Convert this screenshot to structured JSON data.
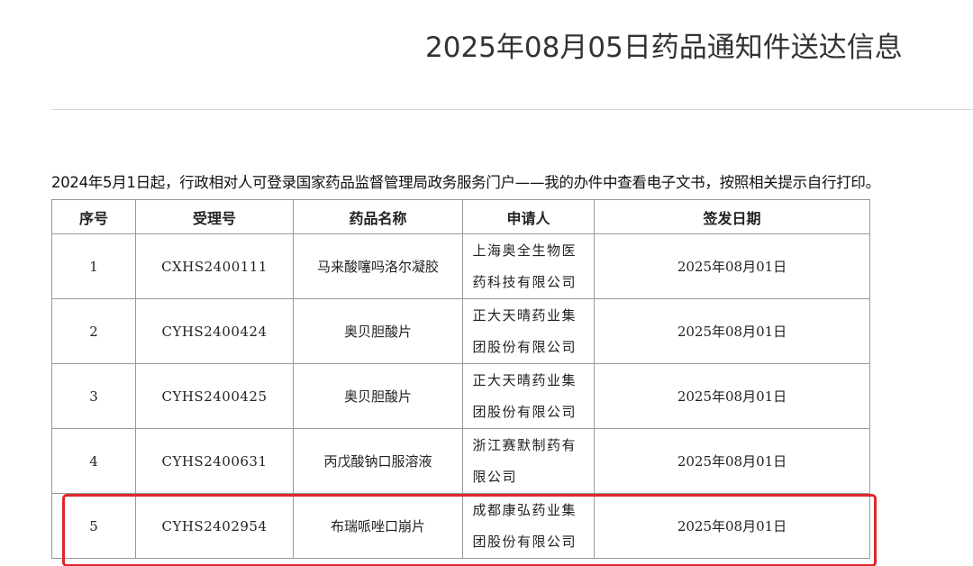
{
  "page": {
    "title": "2025年08月05日药品通知件送达信息",
    "notice": "2024年5月1日起，行政相对人可登录国家药品监督管理局政务服务门户——我的办件中查看电子文书，按照相关提示自行打印。"
  },
  "table": {
    "headers": [
      "序号",
      "受理号",
      "药品名称",
      "申请人",
      "签发日期"
    ],
    "rows": [
      {
        "index": "1",
        "acceptance_no": "CXHS2400111",
        "drug_name": "马来酸噻吗洛尔凝胶",
        "applicant": "上海奥全生物医药科技有限公司",
        "issue_date": "2025年08月01日"
      },
      {
        "index": "2",
        "acceptance_no": "CYHS2400424",
        "drug_name": "奥贝胆酸片",
        "applicant": "正大天晴药业集团股份有限公司",
        "issue_date": "2025年08月01日"
      },
      {
        "index": "3",
        "acceptance_no": "CYHS2400425",
        "drug_name": "奥贝胆酸片",
        "applicant": "正大天晴药业集团股份有限公司",
        "issue_date": "2025年08月01日"
      },
      {
        "index": "4",
        "acceptance_no": "CYHS2400631",
        "drug_name": "丙戊酸钠口服溶液",
        "applicant": "浙江赛默制药有限公司",
        "issue_date": "2025年08月01日"
      },
      {
        "index": "5",
        "acceptance_no": "CYHS2402954",
        "drug_name": "布瑞哌唑口崩片",
        "applicant": "成都康弘药业集团股份有限公司",
        "issue_date": "2025年08月01日"
      }
    ]
  },
  "highlight": {
    "color": "#e0262c",
    "row_index": "5"
  }
}
